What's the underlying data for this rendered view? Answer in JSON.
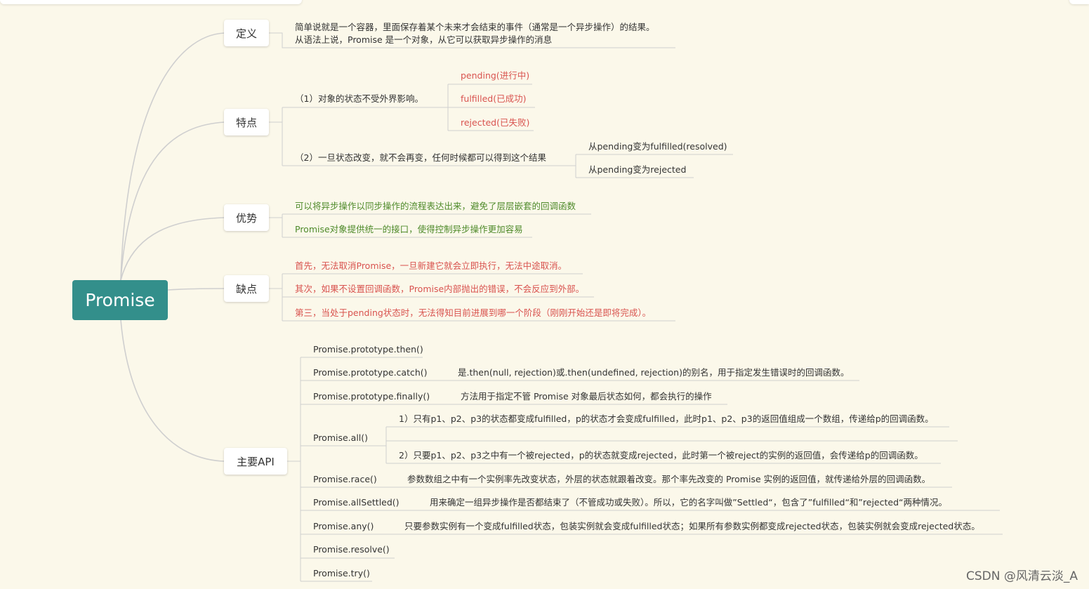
{
  "root": "Promise",
  "branches": {
    "def": "定义",
    "feat": "特点",
    "adv": "优势",
    "dis": "缺点",
    "api": "主要API"
  },
  "def": {
    "line1": "简单说就是一个容器，里面保存着某个未来才会结束的事件（通常是一个异步操作）的结果。",
    "line2": "从语法上说，Promise 是一个对象，从它可以获取异步操作的消息"
  },
  "feat": {
    "p1": "（1）对象的状态不受外界影响。",
    "states": [
      "pending(进行中)",
      "fulfilled(已成功)",
      "rejected(已失败)"
    ],
    "p2": "（2）一旦状态改变，就不会再变，任何时候都可以得到这个结果",
    "changes": [
      "从pending变为fulfilled(resolved)",
      "从pending变为rejected"
    ]
  },
  "adv": [
    "可以将异步操作以同步操作的流程表达出来，避免了层层嵌套的回调函数",
    "Promise对象提供统一的接口，使得控制异步操作更加容易"
  ],
  "dis": [
    "首先，无法取消Promise，一旦新建它就会立即执行，无法中途取消。",
    "其次，如果不设置回调函数，Promise内部抛出的错误，不会反应到外部。",
    "第三，当处于pending状态时，无法得知目前进展到哪一个阶段（刚刚开始还是即将完成）。"
  ],
  "api": {
    "then": "Promise.prototype.then()",
    "catch": "Promise.prototype.catch()",
    "catch_desc": "是.then(null, rejection)或.then(undefined, rejection)的别名，用于指定发生错误时的回调函数。",
    "finally": "Promise.prototype.finally()",
    "finally_desc": "方法用于指定不管 Promise 对象最后状态如何，都会执行的操作",
    "all": "Promise.all()",
    "all_desc1": "1）只有p1、p2、p3的状态都变成fulfilled，p的状态才会变成fulfilled，此时p1、p2、p3的返回值组成一个数组，传递给p的回调函数。",
    "all_desc2": "2）只要p1、p2、p3之中有一个被rejected，p的状态就变成rejected，此时第一个被reject的实例的返回值，会传递给p的回调函数。",
    "race": "Promise.race()",
    "race_desc": "参数数组之中有一个实例率先改变状态，外层的状态就跟着改变。那个率先改变的 Promise 实例的返回值，就传递给外层的回调函数。",
    "allSettled": "Promise.allSettled()",
    "allSettled_desc": "用来确定一组异步操作是否都结束了（不管成功或失败）。所以，它的名字叫做”Settled“，包含了”fulfilled“和”rejected“两种情况。",
    "any": "Promise.any()",
    "any_desc": "只要参数实例有一个变成fulfilled状态，包装实例就会变成fulfilled状态；如果所有参数实例都变成rejected状态，包装实例就会变成rejected状态。",
    "resolve": "Promise.resolve()",
    "try": "Promise.try()"
  },
  "watermark": "CSDN @风清云淡_A",
  "colors": {
    "background": "#fbf8ea",
    "root": "#338f8b",
    "red_text": "#d9534f",
    "green_text": "#4e8a2a",
    "line": "#cfcfcf"
  }
}
